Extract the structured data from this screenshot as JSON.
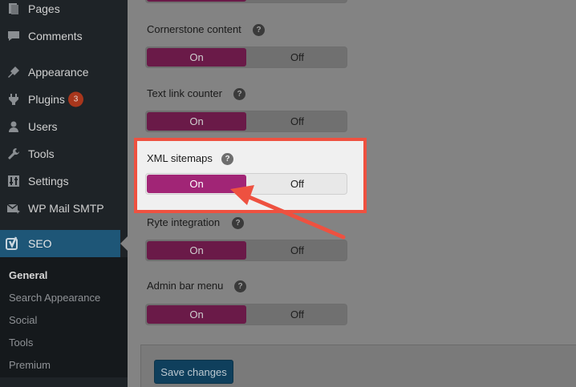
{
  "sidebar": {
    "items": [
      {
        "label": "Pages",
        "icon": "pages-icon"
      },
      {
        "label": "Comments",
        "icon": "comments-icon"
      },
      {
        "label": "Appearance",
        "icon": "appearance-icon"
      },
      {
        "label": "Plugins",
        "icon": "plugins-icon",
        "badge": "3"
      },
      {
        "label": "Users",
        "icon": "users-icon"
      },
      {
        "label": "Tools",
        "icon": "tools-icon"
      },
      {
        "label": "Settings",
        "icon": "settings-icon"
      },
      {
        "label": "WP Mail SMTP",
        "icon": "mail-icon"
      }
    ],
    "active": {
      "label": "SEO",
      "icon": "yoast-icon"
    },
    "submenu": [
      "General",
      "Search Appearance",
      "Social",
      "Tools",
      "Premium"
    ]
  },
  "settings": [
    {
      "label": "Cornerstone content",
      "on": "On",
      "off": "Off",
      "value": "On"
    },
    {
      "label": "Text link counter",
      "on": "On",
      "off": "Off",
      "value": "On"
    },
    {
      "label": "XML sitemaps",
      "on": "On",
      "off": "Off",
      "value": "On"
    },
    {
      "label": "Ryte integration",
      "on": "On",
      "off": "Off",
      "value": "On"
    },
    {
      "label": "Admin bar menu",
      "on": "On",
      "off": "Off",
      "value": "On"
    }
  ],
  "help_glyph": "?",
  "save_button": "Save changes",
  "colors": {
    "accent": "#a12576",
    "highlight_border": "#ee5140",
    "sidebar_active": "#1e5677"
  }
}
